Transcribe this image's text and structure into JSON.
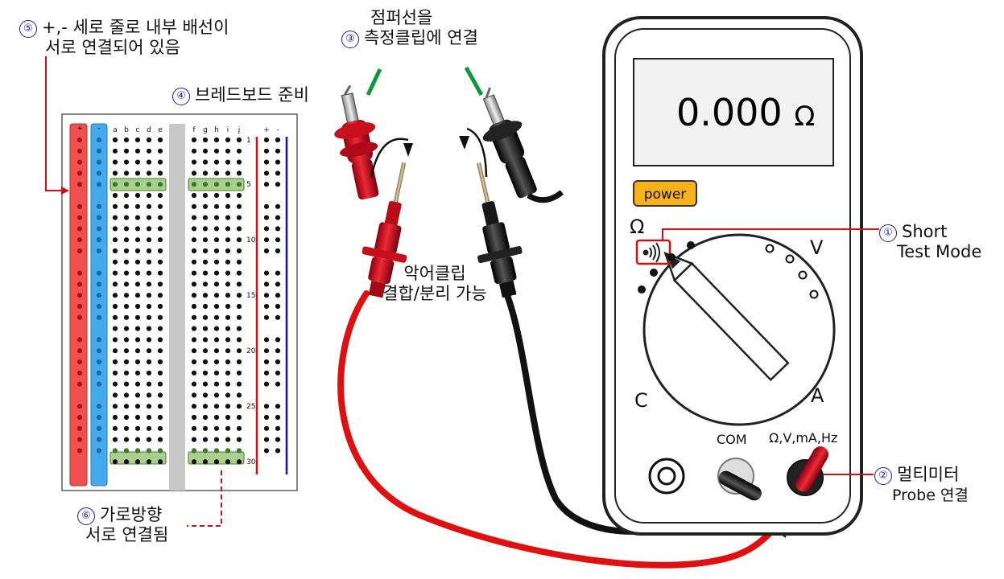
{
  "labels": {
    "l5": {
      "num": "⑤",
      "line1": "+,- 세로 줄로 내부 배선이",
      "line2": "서로 연결되어 있음"
    },
    "l3": {
      "num": "③",
      "line1": "점퍼선을",
      "line2": "측정클립에 연결"
    },
    "l4": {
      "num": "④",
      "text": "브레드보드 준비"
    },
    "l1": {
      "num": "①",
      "line1": "Short",
      "line2": "Test Mode"
    },
    "l2": {
      "num": "②",
      "line1": "멀티미터",
      "line2": "Probe 연결"
    },
    "l6": {
      "num": "⑥",
      "line1": "가로방향",
      "line2": "서로 연결됨"
    },
    "clip": {
      "line1": "악어클립",
      "line2": "결합/분리 가능"
    }
  },
  "multimeter": {
    "display_value": "0.000",
    "display_unit": "Ω",
    "power_label": "power",
    "dial": {
      "ohm": "Ω",
      "volt": "V",
      "cap": "C",
      "amp": "A"
    },
    "ports": {
      "com": "COM",
      "main": "Ω,V,mA,Hz"
    },
    "continuity_icon": "continuity-sound-icon"
  },
  "breadboard": {
    "columns_left": [
      "a",
      "b",
      "c",
      "d",
      "e"
    ],
    "columns_right": [
      "f",
      "g",
      "h",
      "i",
      "j"
    ],
    "rail_labels": [
      "+",
      "-"
    ],
    "row_numbers": [
      "1",
      "5",
      "10",
      "15",
      "20",
      "25",
      "30"
    ]
  },
  "colors": {
    "rail_red": "#f05050",
    "rail_blue": "#44aaee",
    "red_lead": "#e01010",
    "black_lead": "#111111",
    "power_button": "#f7b21a",
    "annotation_red": "#d01010",
    "number_circle": "#1a1aa8"
  }
}
